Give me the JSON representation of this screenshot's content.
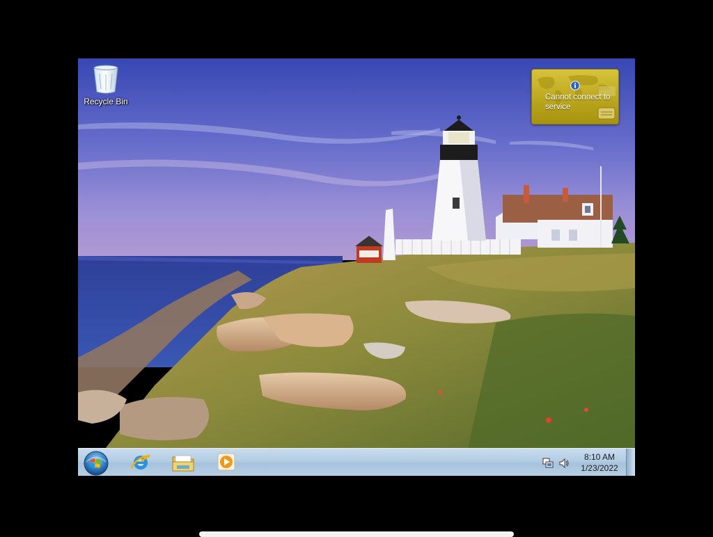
{
  "desktop": {
    "icons": [
      {
        "label": "Recycle Bin",
        "icon": "recycle-bin-icon"
      }
    ]
  },
  "gadget": {
    "message": "Cannot connect to service",
    "icon": "info-icon"
  },
  "taskbar": {
    "start_icon": "windows-start-orb-icon",
    "pinned": [
      {
        "icon": "internet-explorer-icon"
      },
      {
        "icon": "windows-explorer-folder-icon"
      },
      {
        "icon": "windows-media-player-icon"
      }
    ],
    "tray": {
      "icons": [
        "network-icon",
        "volume-icon"
      ],
      "time": "8:10 AM",
      "date": "1/23/2022"
    }
  },
  "colors": {
    "taskbar": "#b3cde3",
    "gadget": "#c9b52c",
    "sky_top": "#3b4fb8",
    "sea": "#2c3f9a"
  }
}
